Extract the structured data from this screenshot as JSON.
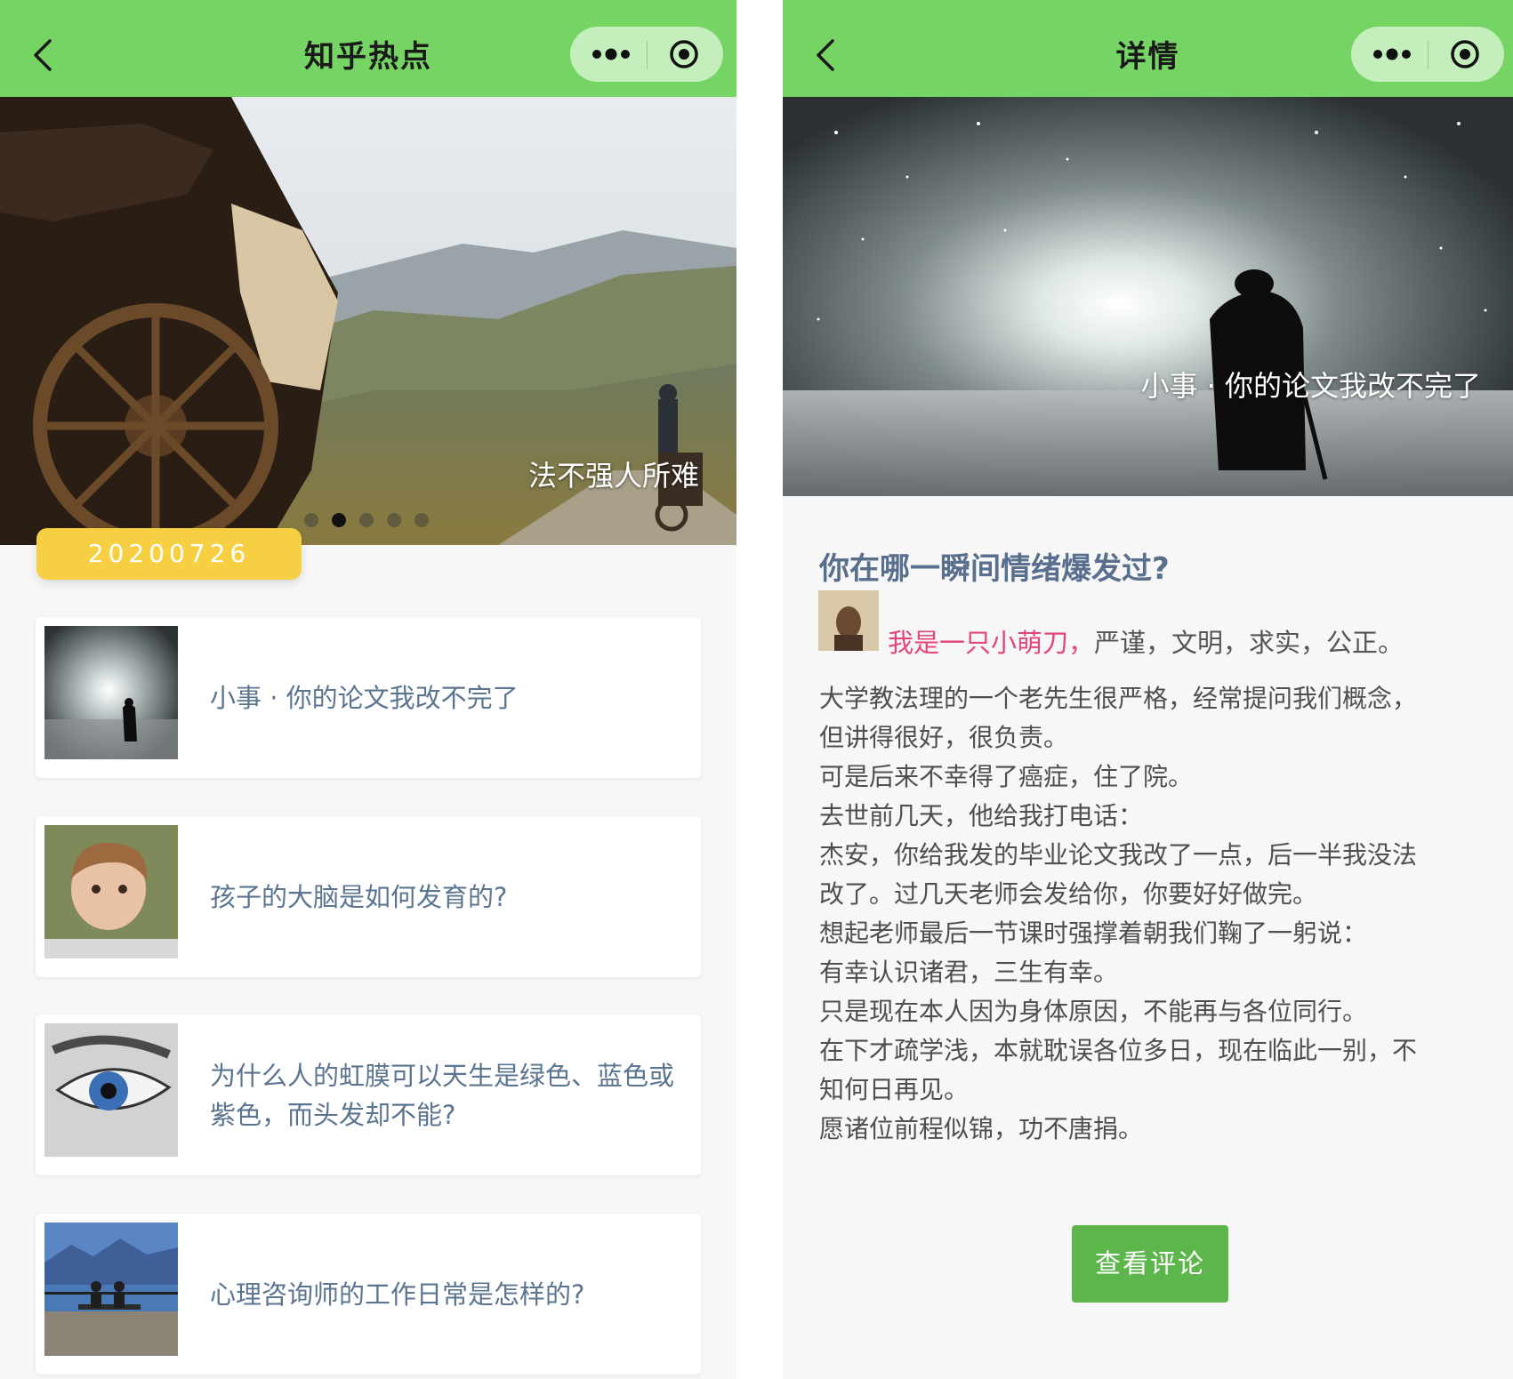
{
  "left_screen": {
    "navbar": {
      "title": "知乎热点"
    },
    "banner": {
      "caption": "法不强人所难",
      "slide_count": 5,
      "active_slide_index": 1
    },
    "date_label": "20200726",
    "articles": [
      {
        "title": "小事 · 你的论文我改不完了",
        "thumb": "night-old-man-image"
      },
      {
        "title": "孩子的大脑是如何发育的?",
        "thumb": "child-portrait-image"
      },
      {
        "title": "为什么人的虹膜可以天生是绿色、蓝色或紫色，而头发却不能?",
        "thumb": "eye-closeup-image"
      },
      {
        "title": "心理咨询师的工作日常是怎样的?",
        "thumb": "lake-bench-image"
      }
    ]
  },
  "right_screen": {
    "navbar": {
      "title": "详情"
    },
    "hero_caption": "小事 · 你的论文我改不完了",
    "article_title": "你在哪一瞬间情绪爆发过?",
    "author_name": "我是一只小萌刀，",
    "author_bio": "严谨，文明，求实，公正。",
    "body_lines": [
      "大学教法理的一个老先生很严格，经常提问我们概念，",
      "但讲得很好，很负责。",
      "可是后来不幸得了癌症，住了院。",
      "去世前几天，他给我打电话：",
      "杰安，你给我发的毕业论文我改了一点，后一半我没法",
      "改了。过几天老师会发给你，你要好好做完。",
      "想起老师最后一节课时强撑着朝我们鞠了一躬说：",
      "有幸认识诸君，三生有幸。",
      "只是现在本人因为身体原因，不能再与各位同行。",
      "在下才疏学浅，本就耽误各位多日，现在临此一别，不",
      "知何日再见。",
      "愿诸位前程似锦，功不唐捐。"
    ],
    "comment_button": "查看评论"
  },
  "colors": {
    "navbar_green": "#76d464",
    "capsule_bg": "#c5eebd",
    "date_pill_yellow": "#f6cf43",
    "link_blue": "#5b7590",
    "author_pink": "#e2467a",
    "button_green": "#5db64b"
  },
  "icons": [
    "back-arrow-icon",
    "more-dots-icon",
    "close-target-icon"
  ]
}
